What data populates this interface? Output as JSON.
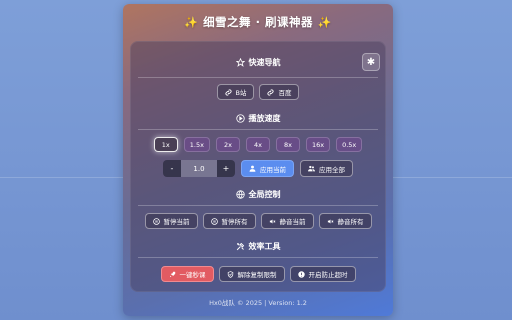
{
  "app": {
    "title_prefix": "✨",
    "title": "细雪之舞 · 刷课神器",
    "title_suffix": "✨"
  },
  "quick_nav": {
    "heading": "快速导航",
    "links": [
      {
        "label": "B站",
        "icon": "link-icon"
      },
      {
        "label": "百度",
        "icon": "link-icon"
      }
    ],
    "settings_icon": "gear-icon"
  },
  "speed": {
    "heading": "播放速度",
    "options": [
      "1x",
      "1.5x",
      "2x",
      "4x",
      "8x",
      "16x",
      "0.5x"
    ],
    "selected": "1x",
    "stepper": {
      "minus": "-",
      "value": "1.0",
      "plus": "+"
    },
    "apply_current": "应用当前",
    "apply_all": "应用全部"
  },
  "global": {
    "heading": "全局控制",
    "pause_current": "暂停当前",
    "pause_all": "暂停所有",
    "mute_current": "静音当前",
    "mute_all": "静音所有"
  },
  "tools": {
    "heading": "效率工具",
    "instant": "一键秒课",
    "unlock_copy": "解除复制限制",
    "anti_timeout": "开启防止超时"
  },
  "footer": {
    "text": "Hx0战队 © 2025 | Version: 1.2"
  },
  "colors": {
    "primary": "#5b8def",
    "danger": "#e25b62",
    "speed_chip": "#6e4b8c",
    "sparkle": "#ffd54a"
  }
}
